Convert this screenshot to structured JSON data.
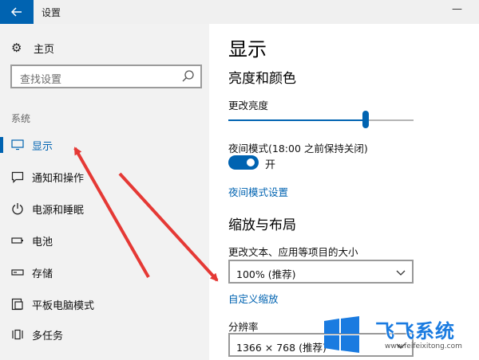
{
  "window": {
    "title": "设置"
  },
  "sidebar": {
    "home_label": "主页",
    "search_placeholder": "查找设置",
    "section_label": "系统",
    "items": [
      {
        "label": "显示",
        "icon": "monitor-icon",
        "active": true
      },
      {
        "label": "通知和操作",
        "icon": "notification-icon"
      },
      {
        "label": "电源和睡眠",
        "icon": "power-icon"
      },
      {
        "label": "电池",
        "icon": "battery-icon"
      },
      {
        "label": "存储",
        "icon": "storage-icon"
      },
      {
        "label": "平板电脑模式",
        "icon": "tablet-mode-icon"
      },
      {
        "label": "多任务",
        "icon": "multitask-icon"
      }
    ]
  },
  "main": {
    "title": "显示",
    "brightness_section": "亮度和颜色",
    "brightness_label": "更改亮度",
    "brightness_value": 0.74,
    "night_mode_label": "夜间模式(18:00 之前保持关闭)",
    "night_mode_state": "开",
    "night_mode_settings_link": "夜间模式设置",
    "scale_section": "缩放与布局",
    "scale_label": "更改文本、应用等项目的大小",
    "scale_value": "100% (推荐)",
    "custom_scale_link": "自定义缩放",
    "resolution_label": "分辨率",
    "resolution_value": "1366 × 768 (推荐)"
  },
  "watermark": {
    "brand": "飞飞系统",
    "url": "www.feifeixitong.com"
  },
  "colors": {
    "accent": "#0063b1",
    "arrow": "#e53935",
    "sidebar_bg": "#f2f2f2"
  }
}
